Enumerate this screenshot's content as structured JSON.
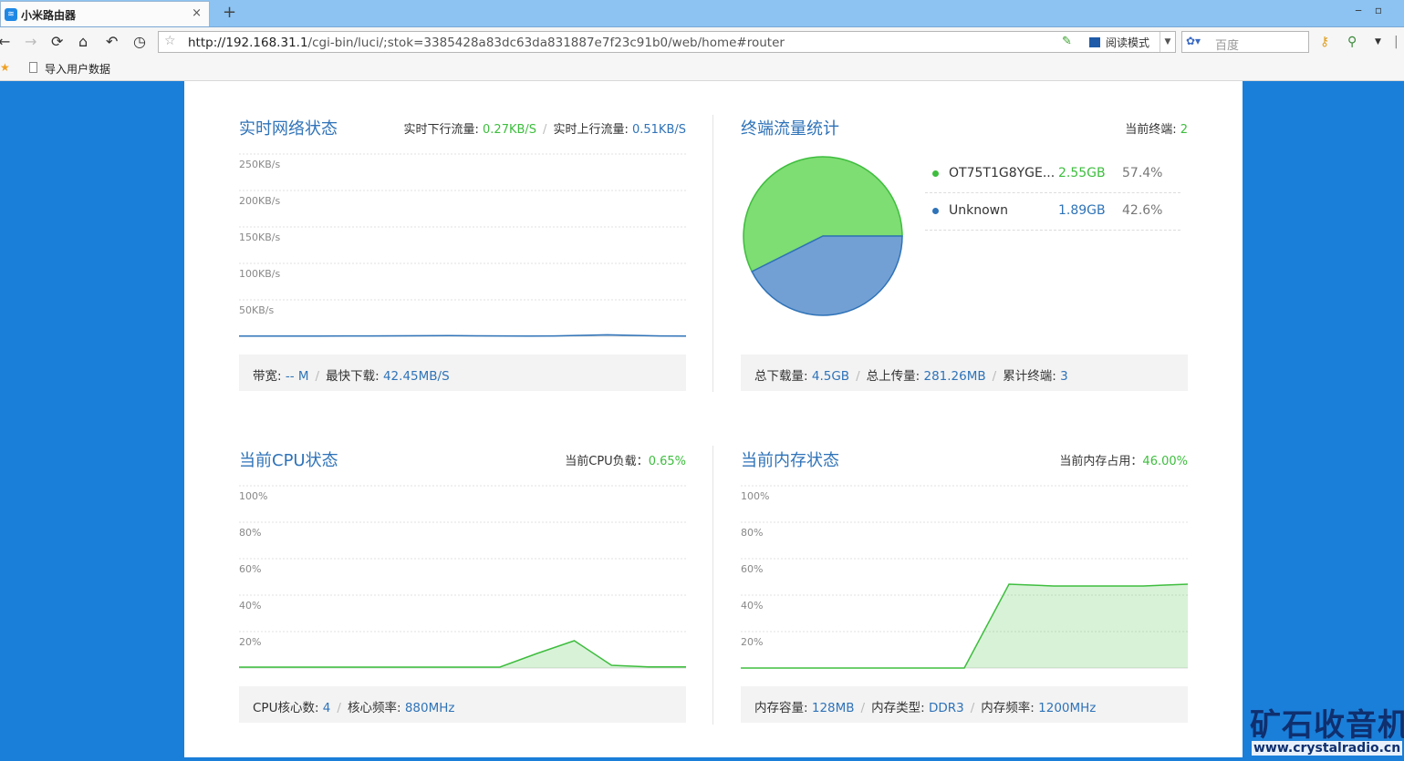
{
  "browser": {
    "tab_title": "小米路由器",
    "tab_close": "×",
    "new_tab": "+",
    "url_host": "http://192.168.31.1",
    "url_path": "/cgi-bin/luci/;stok=3385428a83dc63da831887e7f23c91b0/web/home#router",
    "reading_mode": "阅读模式",
    "search_placeholder": "百度",
    "bookmark_label": "导入用户数据"
  },
  "network": {
    "title": "实时网络状态",
    "down_label": "实时下行流量:",
    "down_value": "0.27KB/S",
    "up_label": "实时上行流量:",
    "up_value": "0.51KB/S",
    "footer": {
      "bandwidth_label": "带宽:",
      "bandwidth_value": "-- M",
      "fastest_label": "最快下载:",
      "fastest_value": "42.45MB/S"
    }
  },
  "terminals": {
    "title": "终端流量统计",
    "current_label": "当前终端:",
    "current_value": "2",
    "devices": [
      {
        "name": "OT75T1G8YGE...",
        "size": "2.55GB",
        "percent": "57.4%",
        "color": "#3ebd3e"
      },
      {
        "name": "Unknown",
        "size": "1.89GB",
        "percent": "42.6%",
        "color": "#2f73b8"
      }
    ],
    "footer": {
      "download_label": "总下载量:",
      "download_value": "4.5GB",
      "upload_label": "总上传量:",
      "upload_value": "281.26MB",
      "total_label": "累计终端:",
      "total_value": "3"
    }
  },
  "cpu": {
    "title": "当前CPU状态",
    "load_label": "当前CPU负载：",
    "load_value": "0.65%",
    "footer": {
      "cores_label": "CPU核心数:",
      "cores_value": "4",
      "freq_label": "核心频率:",
      "freq_value": "880MHz"
    }
  },
  "memory": {
    "title": "当前内存状态",
    "usage_label": "当前内存占用：",
    "usage_value": "46.00%",
    "footer": {
      "capacity_label": "内存容量:",
      "capacity_value": "128MB",
      "type_label": "内存类型:",
      "type_value": "DDR3",
      "freq_label": "内存频率:",
      "freq_value": "1200MHz"
    }
  },
  "watermark": {
    "cn": "矿石收音机",
    "url": "www.crystalradio.cn"
  },
  "chart_data": [
    {
      "type": "area",
      "ylim": [
        0,
        250
      ],
      "ytick_labels": [
        "250KB/s",
        "200KB/s",
        "150KB/s",
        "100KB/s",
        "50KB/s"
      ],
      "ytick_values": [
        250,
        200,
        150,
        100,
        50
      ],
      "series": [
        {
          "values": [
            0.3,
            0.3,
            0.3,
            0.3,
            0.4,
            0.5,
            0.6,
            0.8,
            1.0,
            0.6,
            0.4,
            0.3,
            0.5,
            1.2,
            2.0,
            1.2,
            0.5,
            0.3
          ],
          "color": "#2f73b8"
        }
      ]
    },
    {
      "type": "pie",
      "labels": [
        "OT75T1G8YGE...",
        "Unknown"
      ],
      "values": [
        57.4,
        42.6
      ],
      "colors": [
        "#7edd73",
        "#73a0d4"
      ],
      "stroke_colors": [
        "#3ebd3e",
        "#2f73b8"
      ]
    },
    {
      "type": "area",
      "ylim": [
        0,
        100
      ],
      "ytick_labels": [
        "100%",
        "80%",
        "60%",
        "40%",
        "20%"
      ],
      "ytick_values": [
        100,
        80,
        60,
        40,
        20
      ],
      "series": [
        {
          "values": [
            0.5,
            0.5,
            0.5,
            0.5,
            0.5,
            0.5,
            0.5,
            0.5,
            8,
            15,
            1.5,
            0.65,
            0.65
          ],
          "color": "#3ebd3e"
        }
      ]
    },
    {
      "type": "area",
      "ylim": [
        0,
        100
      ],
      "ytick_labels": [
        "100%",
        "80%",
        "60%",
        "40%",
        "20%"
      ],
      "ytick_values": [
        100,
        80,
        60,
        40,
        20
      ],
      "series": [
        {
          "values": [
            0,
            0,
            0,
            0,
            0,
            0,
            46,
            45,
            45,
            45,
            46
          ],
          "color": "#3ebd3e"
        }
      ]
    }
  ]
}
